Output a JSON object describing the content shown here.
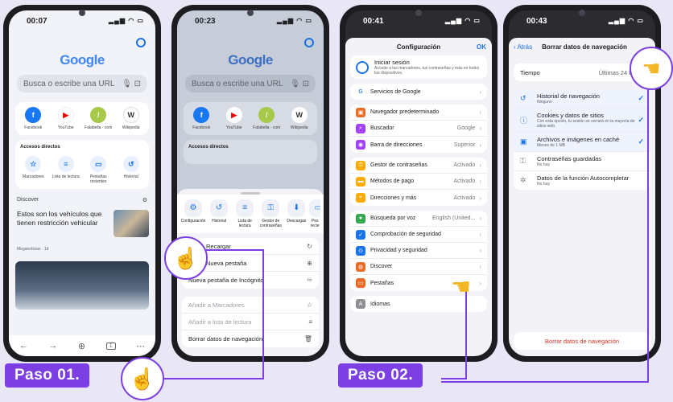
{
  "phone1": {
    "time": "00:07",
    "status_icons": "▂▄▆ ◠ ▭",
    "logo": "Google",
    "search_placeholder": "Busca o escribe una URL",
    "tiles": [
      "Facebook",
      "YouTube",
      "Falabella - com",
      "Wikipedia"
    ],
    "accesos_title": "Accesos directos",
    "accesos": [
      "Marcadores",
      "Lista de lectura",
      "Pestañas recientes",
      "Historial"
    ],
    "discover_title": "Discover",
    "article_title": "Estos son los vehículos que tienen restricción vehicular",
    "article_source": "Meganoticias · 1d",
    "toolbar_tab_count": "1"
  },
  "phone2": {
    "time": "00:23",
    "status_icons": "▂▄▆ ◠ ▭",
    "logo": "Google",
    "search_placeholder": "Busca o escribe una URL",
    "tiles": [
      "Facebook",
      "YouTube",
      "Falabella - com",
      "Wikipedia"
    ],
    "accesos_title": "Accesos directos",
    "actions": [
      "Configuración",
      "Historial",
      "Lista de lectura",
      "Gestor de contraseñas",
      "Descargas",
      "Pes recie"
    ],
    "menu1": [
      "Recargar",
      "Nueva pestaña",
      "Nueva pestaña de Incógnito"
    ],
    "menu2": [
      "Añadir a Marcadores",
      "Añadir a lista de lectura",
      "Borrar datos de navegación"
    ]
  },
  "phone3": {
    "time": "00:41",
    "status_icons": "▂▄▆ ◠ ▭",
    "title": "Configuración",
    "ok": "OK",
    "signin_title": "Iniciar sesión",
    "signin_sub": "Accede a tus marcadores, tus contraseñas y más en todos tus dispositivos.",
    "google_services": "Servicios de Google",
    "group1": [
      {
        "label": "Navegador predeterminado",
        "value": ""
      },
      {
        "label": "Buscador",
        "value": "Google"
      },
      {
        "label": "Barra de direcciones",
        "value": "Superior"
      }
    ],
    "group2": [
      {
        "label": "Gestor de contraseñas",
        "value": "Activado"
      },
      {
        "label": "Métodos de pago",
        "value": "Activado"
      },
      {
        "label": "Direcciones y más",
        "value": "Activado"
      }
    ],
    "group3": [
      {
        "label": "Búsqueda por voz",
        "value": "English (United..."
      },
      {
        "label": "Comprobación de seguridad",
        "value": ""
      },
      {
        "label": "Privacidad y seguridad",
        "value": ""
      },
      {
        "label": "Discover",
        "value": ""
      },
      {
        "label": "Pestañas",
        "value": ""
      }
    ],
    "last": "Idiomas"
  },
  "phone4": {
    "time": "00:43",
    "status_icons": "▂▄▆ ◠ ▭",
    "back": "Atrás",
    "title": "Borrar datos de navegación",
    "tiempo_label": "Tiempo",
    "tiempo_value": "Últimas 24 horas",
    "items": [
      {
        "title": "Historial de navegación",
        "sub": "Ninguno",
        "checked": true
      },
      {
        "title": "Cookies y datos de sitios",
        "sub": "Con esta opción, tu sesión se cerrará en la mayoría de sitios web.",
        "checked": true
      },
      {
        "title": "Archivos e imágenes en caché",
        "sub": "Menos de 1 MB",
        "checked": true
      },
      {
        "title": "Contraseñas guardadas",
        "sub": "No hay",
        "checked": false
      },
      {
        "title": "Datos de la función Autocompletar",
        "sub": "No hay",
        "checked": false
      }
    ],
    "clear_button": "Borrar datos de navegación"
  },
  "labels": {
    "step1": "Paso 01.",
    "step2": "Paso 02."
  },
  "colors": {
    "accent": "#7b3fe4",
    "hand": "#f5b623",
    "blue": "#1a73e8"
  }
}
